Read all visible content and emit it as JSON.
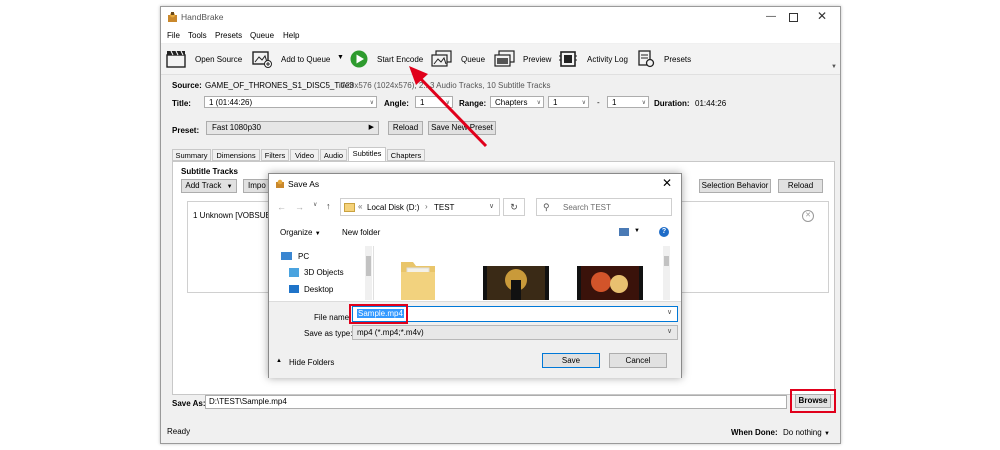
{
  "app": {
    "title": "HandBrake",
    "menu": [
      "File",
      "Tools",
      "Presets",
      "Queue",
      "Help"
    ],
    "toolbar": {
      "open_source": "Open Source",
      "add_to_queue": "Add to Queue",
      "start_encode": "Start Encode",
      "queue": "Queue",
      "preview": "Preview",
      "activity_log": "Activity Log",
      "presets": "Presets"
    }
  },
  "source": {
    "label": "Source:",
    "name": "GAME_OF_THRONES_S1_DISC5_Title3",
    "info": "720x576 (1024x576), 2...3 Audio Tracks, 10 Subtitle Tracks"
  },
  "title_row": {
    "title_label": "Title:",
    "title_value": "1 (01:44:26)",
    "angle_label": "Angle:",
    "angle_value": "1",
    "range_label": "Range:",
    "range_type": "Chapters",
    "range_start": "1",
    "range_sep": "-",
    "range_end": "1",
    "duration_label": "Duration:",
    "duration_value": "01:44:26"
  },
  "preset_row": {
    "label": "Preset:",
    "value": "Fast 1080p30",
    "reload": "Reload",
    "save_new": "Save New Preset"
  },
  "tabs": [
    "Summary",
    "Dimensions",
    "Filters",
    "Video",
    "Audio",
    "Subtitles",
    "Chapters"
  ],
  "subtitles": {
    "heading": "Subtitle Tracks",
    "add_track": "Add Track",
    "import": "Impo",
    "selection_behavior": "Selection Behavior",
    "reload": "Reload",
    "track": "1 Unknown [VOBSUB]"
  },
  "save_as": {
    "label": "Save As:",
    "value": "D:\\TEST\\Sample.mp4",
    "browse": "Browse"
  },
  "status": {
    "left": "Ready",
    "when_done_label": "When Done:",
    "when_done_value": "Do nothing"
  },
  "dialog": {
    "title": "Save As",
    "path_prefix": "«",
    "path_drive": "Local Disk (D:)",
    "path_sep": "›",
    "path_folder": "TEST",
    "search_placeholder": "Search TEST",
    "organize": "Organize",
    "new_folder": "New folder",
    "nav": [
      "PC",
      "3D Objects",
      "Desktop"
    ],
    "file_name_label": "File name:",
    "file_name_value": "Sample.mp4",
    "save_type_label": "Save as type:",
    "save_type_value": "mp4 (*.mp4;*.m4v)",
    "hide_folders": "Hide Folders",
    "save": "Save",
    "cancel": "Cancel"
  },
  "colors": {
    "annotation_red": "#e0001b",
    "selection_blue": "#3399ff",
    "play_green": "#2e9b2e"
  }
}
